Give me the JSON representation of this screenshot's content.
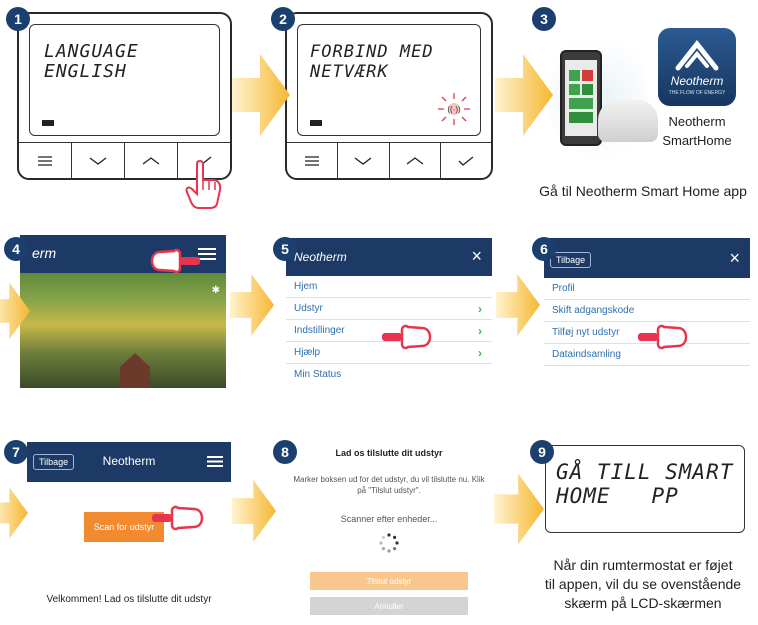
{
  "steps": [
    "1",
    "2",
    "3",
    "4",
    "5",
    "6",
    "7",
    "8",
    "9"
  ],
  "step1": {
    "lcd_line1": "LANGUAGE",
    "lcd_line2": "ENGLISH"
  },
  "step2": {
    "lcd_line1": "FORBIND MED",
    "lcd_line2": "NETVÆRK"
  },
  "step3": {
    "app_name_line1": "Neotherm",
    "app_name_line2": "SmartHome",
    "tile_brand": "Neotherm",
    "tile_tagline": "THE FLOW OF ENERGY",
    "caption": "Gå til Neotherm Smart Home app"
  },
  "step4": {
    "brand_partial": "erm"
  },
  "step5": {
    "brand": "Neotherm",
    "close": "×",
    "menu": [
      "Hjem",
      "Udstyr",
      "Indstillinger",
      "Hjælp",
      "Min Status"
    ]
  },
  "step6": {
    "back": "Tilbage",
    "close": "×",
    "menu": [
      "Profil",
      "Skift adgangskode",
      "Tilføj nyt udstyr",
      "Dataindsamling"
    ]
  },
  "step7": {
    "back": "Tilbage",
    "brand": "Neotherm",
    "scan_button": "Scan for udstyr",
    "welcome": "Velkommen! Lad os tilslutte dit udstyr"
  },
  "step8": {
    "title": "Lad os tilslutte dit udstyr",
    "instruction": "Marker boksen ud for det udstyr, du vil tilslutte nu. Klik på \"Tilslut udstyr\".",
    "scanning": "Scanner efter enheder...",
    "connect_button": "Tilslut udstyr",
    "cancel_button": "Annuller"
  },
  "step9": {
    "lcd_line1": "GÅ TILL SMART",
    "lcd_line2": "HOME   PP",
    "caption_line1": "Når din rumtermostat er føjet",
    "caption_line2": "til appen, vil du se ovenstående",
    "caption_line3": "skærm på LCD-skærmen"
  },
  "colors": {
    "badge": "#1b3f6e",
    "navbar": "#1d3a66",
    "arrow": "#f5b731",
    "scan_button": "#f28a30",
    "hand": "#e8344e"
  }
}
